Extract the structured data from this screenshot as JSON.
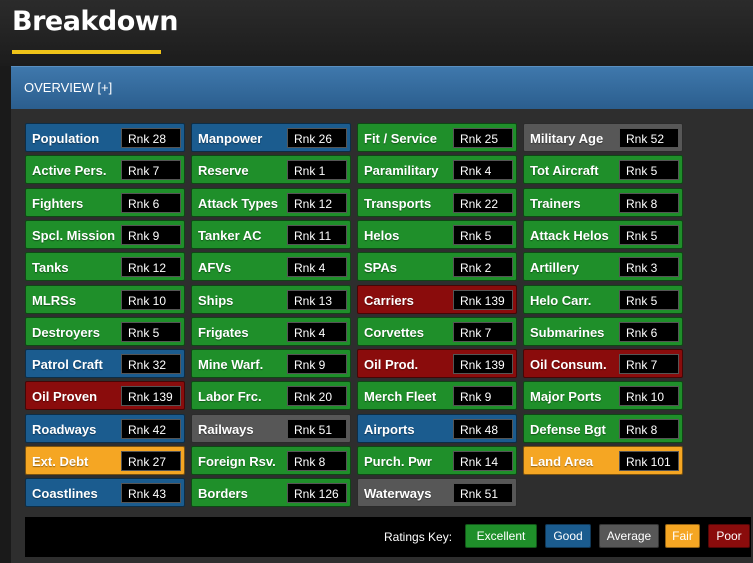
{
  "page": {
    "title": "Breakdown"
  },
  "panel": {
    "header_label": "OVERVIEW [+]"
  },
  "colors": {
    "excellent": "#1f8f2a",
    "good": "#1b5c8f",
    "average": "#575757",
    "fair": "#f5a623",
    "poor": "#8a0c0c"
  },
  "tiles": [
    {
      "label": "Population",
      "rank": "Rnk 28",
      "rating": "good"
    },
    {
      "label": "Manpower",
      "rank": "Rnk 26",
      "rating": "good"
    },
    {
      "label": "Fit / Service",
      "rank": "Rnk 25",
      "rating": "excellent"
    },
    {
      "label": "Military Age",
      "rank": "Rnk 52",
      "rating": "average"
    },
    {
      "label": "Active Pers.",
      "rank": "Rnk 7",
      "rating": "excellent"
    },
    {
      "label": "Reserve",
      "rank": "Rnk 1",
      "rating": "excellent"
    },
    {
      "label": "Paramilitary",
      "rank": "Rnk 4",
      "rating": "excellent"
    },
    {
      "label": "Tot Aircraft",
      "rank": "Rnk 5",
      "rating": "excellent"
    },
    {
      "label": "Fighters",
      "rank": "Rnk 6",
      "rating": "excellent"
    },
    {
      "label": "Attack Types",
      "rank": "Rnk 12",
      "rating": "excellent"
    },
    {
      "label": "Transports",
      "rank": "Rnk 22",
      "rating": "excellent"
    },
    {
      "label": "Trainers",
      "rank": "Rnk 8",
      "rating": "excellent"
    },
    {
      "label": "Spcl. Mission",
      "rank": "Rnk 9",
      "rating": "excellent"
    },
    {
      "label": "Tanker AC",
      "rank": "Rnk 11",
      "rating": "excellent"
    },
    {
      "label": "Helos",
      "rank": "Rnk 5",
      "rating": "excellent"
    },
    {
      "label": "Attack Helos",
      "rank": "Rnk 5",
      "rating": "excellent"
    },
    {
      "label": "Tanks",
      "rank": "Rnk 12",
      "rating": "excellent"
    },
    {
      "label": "AFVs",
      "rank": "Rnk 4",
      "rating": "excellent"
    },
    {
      "label": "SPAs",
      "rank": "Rnk 2",
      "rating": "excellent"
    },
    {
      "label": "Artillery",
      "rank": "Rnk 3",
      "rating": "excellent"
    },
    {
      "label": "MLRSs",
      "rank": "Rnk 10",
      "rating": "excellent"
    },
    {
      "label": "Ships",
      "rank": "Rnk 13",
      "rating": "excellent"
    },
    {
      "label": "Carriers",
      "rank": "Rnk 139",
      "rating": "poor"
    },
    {
      "label": "Helo Carr.",
      "rank": "Rnk 5",
      "rating": "excellent"
    },
    {
      "label": "Destroyers",
      "rank": "Rnk 5",
      "rating": "excellent"
    },
    {
      "label": "Frigates",
      "rank": "Rnk 4",
      "rating": "excellent"
    },
    {
      "label": "Corvettes",
      "rank": "Rnk 7",
      "rating": "excellent"
    },
    {
      "label": "Submarines",
      "rank": "Rnk 6",
      "rating": "excellent"
    },
    {
      "label": "Patrol Craft",
      "rank": "Rnk 32",
      "rating": "good"
    },
    {
      "label": "Mine Warf.",
      "rank": "Rnk 9",
      "rating": "excellent"
    },
    {
      "label": "Oil Prod.",
      "rank": "Rnk 139",
      "rating": "poor"
    },
    {
      "label": "Oil Consum.",
      "rank": "Rnk 7",
      "rating": "poor"
    },
    {
      "label": "Oil Proven",
      "rank": "Rnk 139",
      "rating": "poor"
    },
    {
      "label": "Labor Frc.",
      "rank": "Rnk 20",
      "rating": "excellent"
    },
    {
      "label": "Merch Fleet",
      "rank": "Rnk 9",
      "rating": "excellent"
    },
    {
      "label": "Major Ports",
      "rank": "Rnk 10",
      "rating": "excellent"
    },
    {
      "label": "Roadways",
      "rank": "Rnk 42",
      "rating": "good"
    },
    {
      "label": "Railways",
      "rank": "Rnk 51",
      "rating": "average"
    },
    {
      "label": "Airports",
      "rank": "Rnk 48",
      "rating": "good"
    },
    {
      "label": "Defense Bgt",
      "rank": "Rnk 8",
      "rating": "excellent"
    },
    {
      "label": "Ext. Debt",
      "rank": "Rnk 27",
      "rating": "fair"
    },
    {
      "label": "Foreign Rsv.",
      "rank": "Rnk 8",
      "rating": "excellent"
    },
    {
      "label": "Purch. Pwr",
      "rank": "Rnk 14",
      "rating": "excellent"
    },
    {
      "label": "Land Area",
      "rank": "Rnk 101",
      "rating": "fair"
    },
    {
      "label": "Coastlines",
      "rank": "Rnk 43",
      "rating": "good"
    },
    {
      "label": "Borders",
      "rank": "Rnk 126",
      "rating": "excellent"
    },
    {
      "label": "Waterways",
      "rank": "Rnk 51",
      "rating": "average"
    }
  ],
  "ratings_key": {
    "label": "Ratings Key:",
    "items": [
      {
        "label": "Excellent",
        "rating": "excellent"
      },
      {
        "label": "Good",
        "rating": "good"
      },
      {
        "label": "Average",
        "rating": "average"
      },
      {
        "label": "Fair",
        "rating": "fair"
      },
      {
        "label": "Poor",
        "rating": "poor"
      }
    ]
  }
}
